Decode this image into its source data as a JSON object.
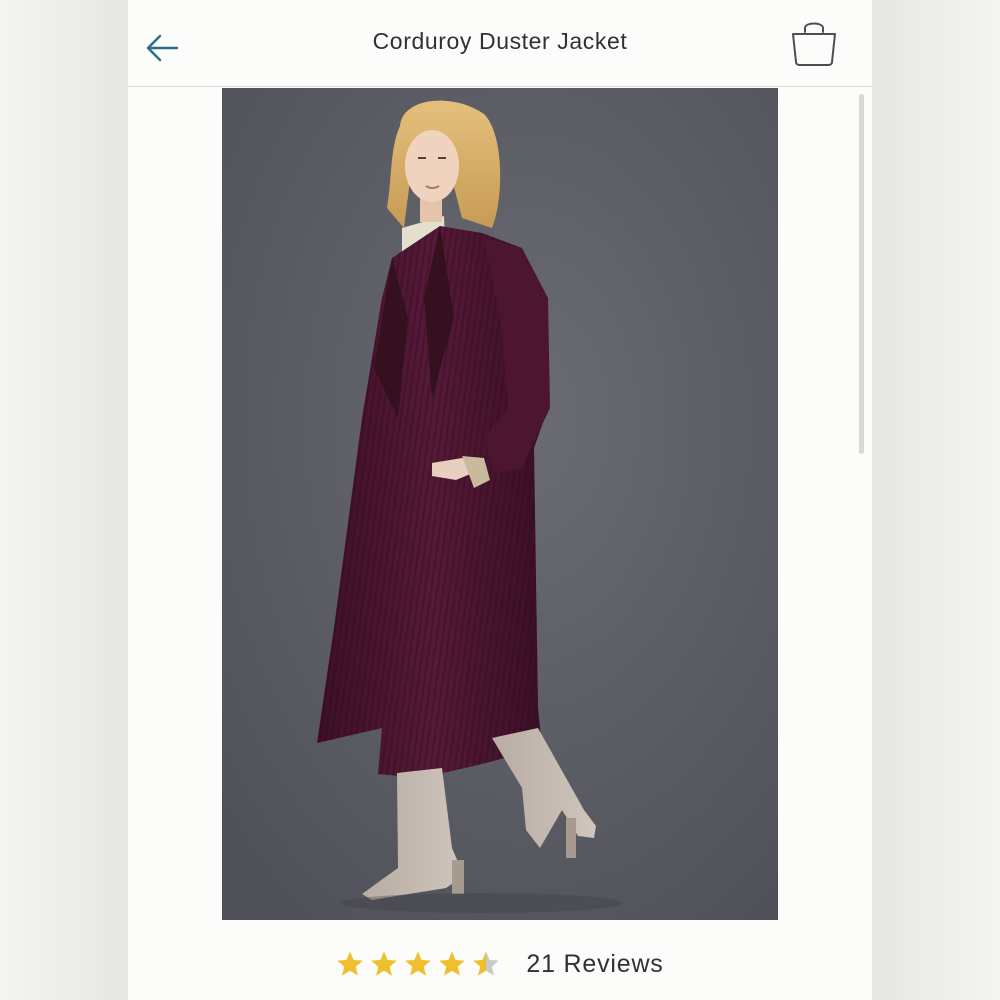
{
  "header": {
    "title": "Corduroy Duster Jacket",
    "back_icon": "arrow-left-icon",
    "bag_icon": "shopping-bag-icon"
  },
  "product": {
    "image_description_icon": "product-photo"
  },
  "rating": {
    "value": 4.5,
    "max": 5,
    "reviews_label": "21 Reviews"
  },
  "colors": {
    "accent": "#2a6d8c",
    "star": "#f0bf2d",
    "star_empty": "#c9c9c9",
    "text": "#2f3138",
    "background": "#fcfcfa",
    "photo_backdrop": "#5d5e66",
    "coat": "#4a1530"
  }
}
